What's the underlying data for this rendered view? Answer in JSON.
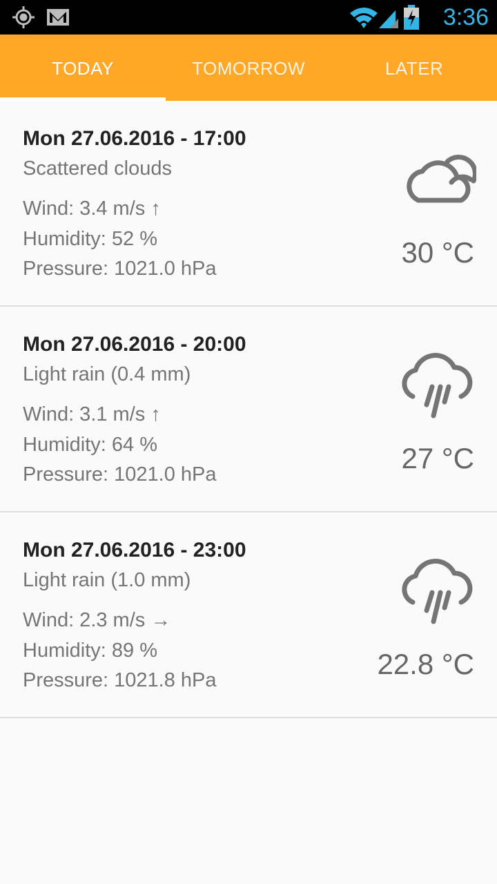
{
  "status_bar": {
    "time": "3:36",
    "icons": [
      "location-icon",
      "gmail-icon",
      "wifi-icon",
      "signal-icon",
      "battery-charging-icon"
    ]
  },
  "tabs": [
    {
      "label": "TODAY"
    },
    {
      "label": "TOMORROW"
    },
    {
      "label": "LATER"
    }
  ],
  "forecasts": [
    {
      "date": "Mon 27.06.2016 - 17:00",
      "description": "Scattered clouds",
      "wind": "Wind: 3.4 m/s ↑",
      "humidity": "Humidity: 52 %",
      "pressure": "Pressure: 1021.0 hPa",
      "temperature": "30 °C",
      "icon": "cloud-icon"
    },
    {
      "date": "Mon 27.06.2016 - 20:00",
      "description": "Light rain (0.4 mm)",
      "wind": "Wind: 3.1 m/s ↑",
      "humidity": "Humidity: 64 %",
      "pressure": "Pressure: 1021.0 hPa",
      "temperature": "27 °C",
      "icon": "rain-icon"
    },
    {
      "date": "Mon 27.06.2016 - 23:00",
      "description": "Light rain (1.0 mm)",
      "wind": "Wind: 2.3 m/s →",
      "humidity": "Humidity: 89 %",
      "pressure": "Pressure: 1021.8 hPa",
      "temperature": "22.8 °C",
      "icon": "rain-icon"
    }
  ],
  "colors": {
    "accent": "#ffa726",
    "status_time": "#33b5e5",
    "text_primary": "#222222",
    "text_secondary": "#757575"
  }
}
